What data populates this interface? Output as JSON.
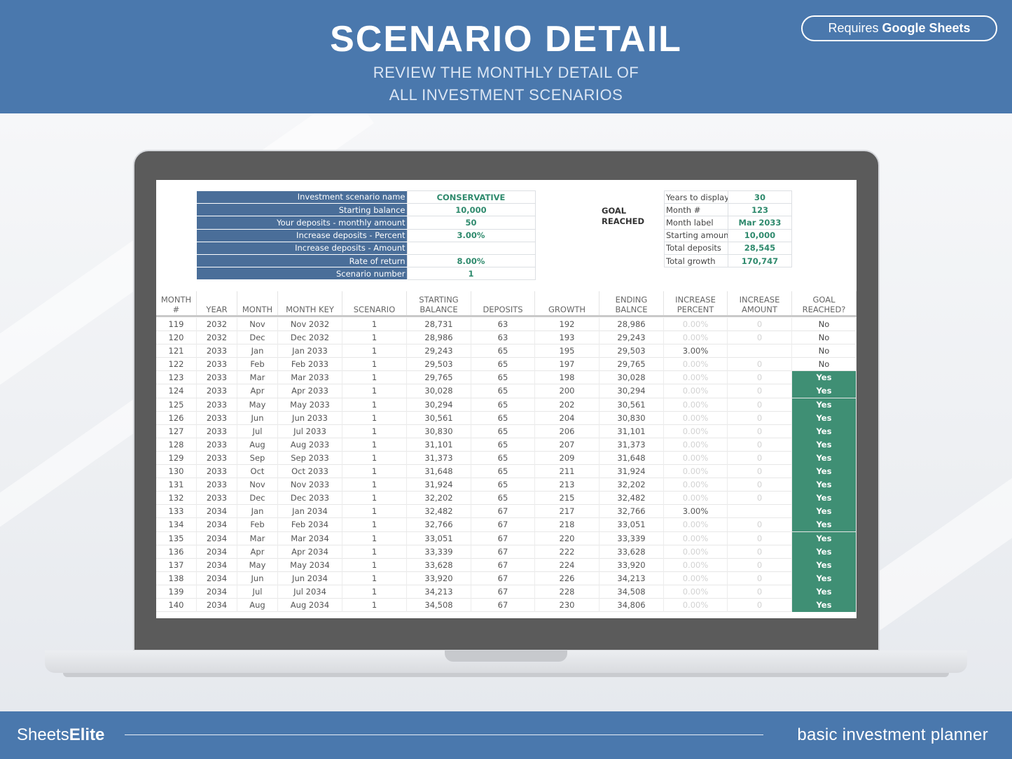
{
  "header": {
    "title": "SCENARIO DETAIL",
    "subtitle_line1": "REVIEW THE MONTHLY DETAIL OF",
    "subtitle_line2": "ALL INVESTMENT SCENARIOS",
    "badge_prefix": "Requires ",
    "badge_strong": "Google Sheets"
  },
  "scenario_info": [
    {
      "label": "Investment scenario name",
      "value": "CONSERVATIVE"
    },
    {
      "label": "Starting balance",
      "value": "10,000"
    },
    {
      "label": "Your deposits - monthly amount",
      "value": "50"
    },
    {
      "label": "Increase deposits - Percent",
      "value": "3.00%"
    },
    {
      "label": "Increase deposits - Amount",
      "value": ""
    },
    {
      "label": "Rate of return",
      "value": "8.00%"
    },
    {
      "label": "Scenario number",
      "value": "1"
    }
  ],
  "goal_reached": {
    "label_line1": "GOAL",
    "label_line2": "REACHED",
    "items": [
      {
        "label": "Years to display",
        "value": "30"
      },
      {
        "label": "Month #",
        "value": "123"
      },
      {
        "label": "Month label",
        "value": "Mar 2033"
      },
      {
        "label": "Starting amount",
        "value": "10,000"
      },
      {
        "label": "Total deposits",
        "value": "28,545"
      },
      {
        "label": "Total growth",
        "value": "170,747"
      }
    ]
  },
  "columns": [
    "MONTH\n#",
    "YEAR",
    "MONTH",
    "MONTH KEY",
    "SCENARIO",
    "STARTING\nBALANCE",
    "DEPOSITS",
    "GROWTH",
    "ENDING\nBALNCE",
    "INCREASE\nPERCENT",
    "INCREASE\nAMOUNT",
    "GOAL\nREACHED?"
  ],
  "rows": [
    [
      "119",
      "2032",
      "Nov",
      "Nov 2032",
      "1",
      "28,731",
      "63",
      "192",
      "28,986",
      "0.00%",
      "0",
      "No"
    ],
    [
      "120",
      "2032",
      "Dec",
      "Dec 2032",
      "1",
      "28,986",
      "63",
      "193",
      "29,243",
      "0.00%",
      "0",
      "No"
    ],
    [
      "121",
      "2033",
      "Jan",
      "Jan 2033",
      "1",
      "29,243",
      "65",
      "195",
      "29,503",
      "3.00%",
      "",
      "No"
    ],
    [
      "122",
      "2033",
      "Feb",
      "Feb 2033",
      "1",
      "29,503",
      "65",
      "197",
      "29,765",
      "0.00%",
      "0",
      "No"
    ],
    [
      "123",
      "2033",
      "Mar",
      "Mar 2033",
      "1",
      "29,765",
      "65",
      "198",
      "30,028",
      "0.00%",
      "0",
      "Yes"
    ],
    [
      "124",
      "2033",
      "Apr",
      "Apr 2033",
      "1",
      "30,028",
      "65",
      "200",
      "30,294",
      "0.00%",
      "0",
      "Yes"
    ],
    [
      "125",
      "2033",
      "May",
      "May 2033",
      "1",
      "30,294",
      "65",
      "202",
      "30,561",
      "0.00%",
      "0",
      "Yes"
    ],
    [
      "126",
      "2033",
      "Jun",
      "Jun 2033",
      "1",
      "30,561",
      "65",
      "204",
      "30,830",
      "0.00%",
      "0",
      "Yes"
    ],
    [
      "127",
      "2033",
      "Jul",
      "Jul 2033",
      "1",
      "30,830",
      "65",
      "206",
      "31,101",
      "0.00%",
      "0",
      "Yes"
    ],
    [
      "128",
      "2033",
      "Aug",
      "Aug 2033",
      "1",
      "31,101",
      "65",
      "207",
      "31,373",
      "0.00%",
      "0",
      "Yes"
    ],
    [
      "129",
      "2033",
      "Sep",
      "Sep 2033",
      "1",
      "31,373",
      "65",
      "209",
      "31,648",
      "0.00%",
      "0",
      "Yes"
    ],
    [
      "130",
      "2033",
      "Oct",
      "Oct 2033",
      "1",
      "31,648",
      "65",
      "211",
      "31,924",
      "0.00%",
      "0",
      "Yes"
    ],
    [
      "131",
      "2033",
      "Nov",
      "Nov 2033",
      "1",
      "31,924",
      "65",
      "213",
      "32,202",
      "0.00%",
      "0",
      "Yes"
    ],
    [
      "132",
      "2033",
      "Dec",
      "Dec 2033",
      "1",
      "32,202",
      "65",
      "215",
      "32,482",
      "0.00%",
      "0",
      "Yes"
    ],
    [
      "133",
      "2034",
      "Jan",
      "Jan 2034",
      "1",
      "32,482",
      "67",
      "217",
      "32,766",
      "3.00%",
      "",
      "Yes"
    ],
    [
      "134",
      "2034",
      "Feb",
      "Feb 2034",
      "1",
      "32,766",
      "67",
      "218",
      "33,051",
      "0.00%",
      "0",
      "Yes"
    ],
    [
      "135",
      "2034",
      "Mar",
      "Mar 2034",
      "1",
      "33,051",
      "67",
      "220",
      "33,339",
      "0.00%",
      "0",
      "Yes"
    ],
    [
      "136",
      "2034",
      "Apr",
      "Apr 2034",
      "1",
      "33,339",
      "67",
      "222",
      "33,628",
      "0.00%",
      "0",
      "Yes"
    ],
    [
      "137",
      "2034",
      "May",
      "May 2034",
      "1",
      "33,628",
      "67",
      "224",
      "33,920",
      "0.00%",
      "0",
      "Yes"
    ],
    [
      "138",
      "2034",
      "Jun",
      "Jun 2034",
      "1",
      "33,920",
      "67",
      "226",
      "34,213",
      "0.00%",
      "0",
      "Yes"
    ],
    [
      "139",
      "2034",
      "Jul",
      "Jul 2034",
      "1",
      "34,213",
      "67",
      "228",
      "34,508",
      "0.00%",
      "0",
      "Yes"
    ],
    [
      "140",
      "2034",
      "Aug",
      "Aug 2034",
      "1",
      "34,508",
      "67",
      "230",
      "34,806",
      "0.00%",
      "0",
      "Yes"
    ]
  ],
  "footer": {
    "brand_prefix": "Sheets",
    "brand_strong": "Elite",
    "tagline": "basic investment planner"
  },
  "colors": {
    "brand_blue": "#4a78ad",
    "label_blue": "#4a6e99",
    "goal_green": "#3f8f74",
    "value_green": "#2f8a6d"
  }
}
